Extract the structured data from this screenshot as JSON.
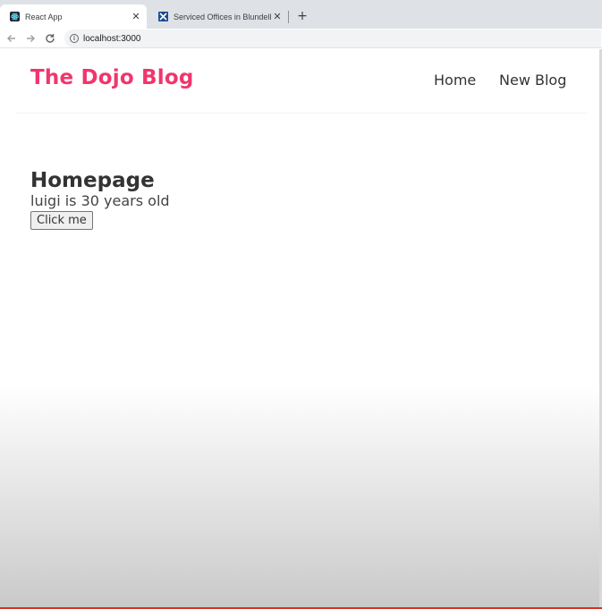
{
  "browser": {
    "tabs": [
      {
        "title": "React App",
        "icon": "react-icon",
        "active": true
      },
      {
        "title": "Serviced Offices in Blundellsands",
        "icon": "x-brand-icon",
        "active": false
      }
    ],
    "close_glyph": "✕",
    "new_tab_glyph": "+",
    "url": "localhost:3000",
    "info_glyph": "i"
  },
  "app": {
    "brand": "The Dojo Blog",
    "nav": [
      {
        "label": "Home"
      },
      {
        "label": "New Blog"
      }
    ],
    "page": {
      "title": "Homepage",
      "message": "luigi is 30 years old",
      "button_label": "Click me"
    }
  },
  "colors": {
    "brand": "#f1356d",
    "text": "#333333",
    "tabbar": "#dee1e6"
  }
}
